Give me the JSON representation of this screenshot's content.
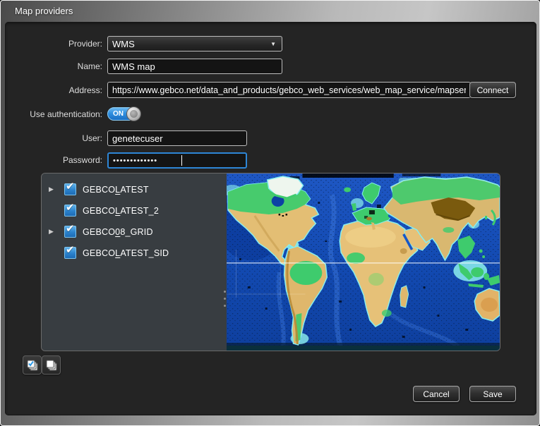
{
  "window": {
    "title": "Map providers"
  },
  "form": {
    "provider": {
      "label": "Provider:",
      "value": "WMS"
    },
    "name": {
      "label": "Name:",
      "value": "WMS map"
    },
    "address": {
      "label": "Address:",
      "value": "https://www.gebco.net/data_and_products/gebco_web_services/web_map_service/mapserv?"
    },
    "connect_button": "Connect",
    "auth": {
      "label": "Use authentication:",
      "state": "ON"
    },
    "user": {
      "label": "User:",
      "value": "genetecuser"
    },
    "password": {
      "label": "Password:",
      "masked_value": "•••••••••••••"
    }
  },
  "layers": {
    "items": [
      {
        "arrow": "▶",
        "check": "✔",
        "pre": "GEBCO",
        "mnemonic": "L",
        "post": "ATEST"
      },
      {
        "arrow": "",
        "check": "✔",
        "pre": "GEBCO",
        "mnemonic": "L",
        "post": "ATEST_2"
      },
      {
        "arrow": "▶",
        "check": "✔",
        "pre": "GEBCO",
        "mnemonic": "0",
        "post": "8_GRID"
      },
      {
        "arrow": "",
        "check": "✔",
        "pre": "GEBCO",
        "mnemonic": "L",
        "post": "ATEST_SID"
      }
    ]
  },
  "icons": {
    "dropdown_arrow": "▼",
    "check_all": "check-all-layers-icon",
    "uncheck_all": "uncheck-all-layers-icon"
  },
  "footer": {
    "cancel_label": "Cancel",
    "save_label": "Save"
  },
  "colors": {
    "accent_blue": "#2e86d6",
    "checkbox_blue": "#2a82cc",
    "toggle_blue": "#2f8fe0",
    "focus_border": "#2e86d6",
    "dialog_bg": "#242424",
    "panel_bg": "#383d41",
    "ocean_deep": "#0e3f9e",
    "ocean_mid": "#1a52c0",
    "shelf_cyan": "#8df0ee",
    "land_tan": "#e3be74",
    "land_green": "#3ecb6d",
    "highland_brown": "#7a5a0e"
  },
  "map_preview": {
    "description": "GEBCO bathymetry world map preview",
    "equator_line": true
  }
}
